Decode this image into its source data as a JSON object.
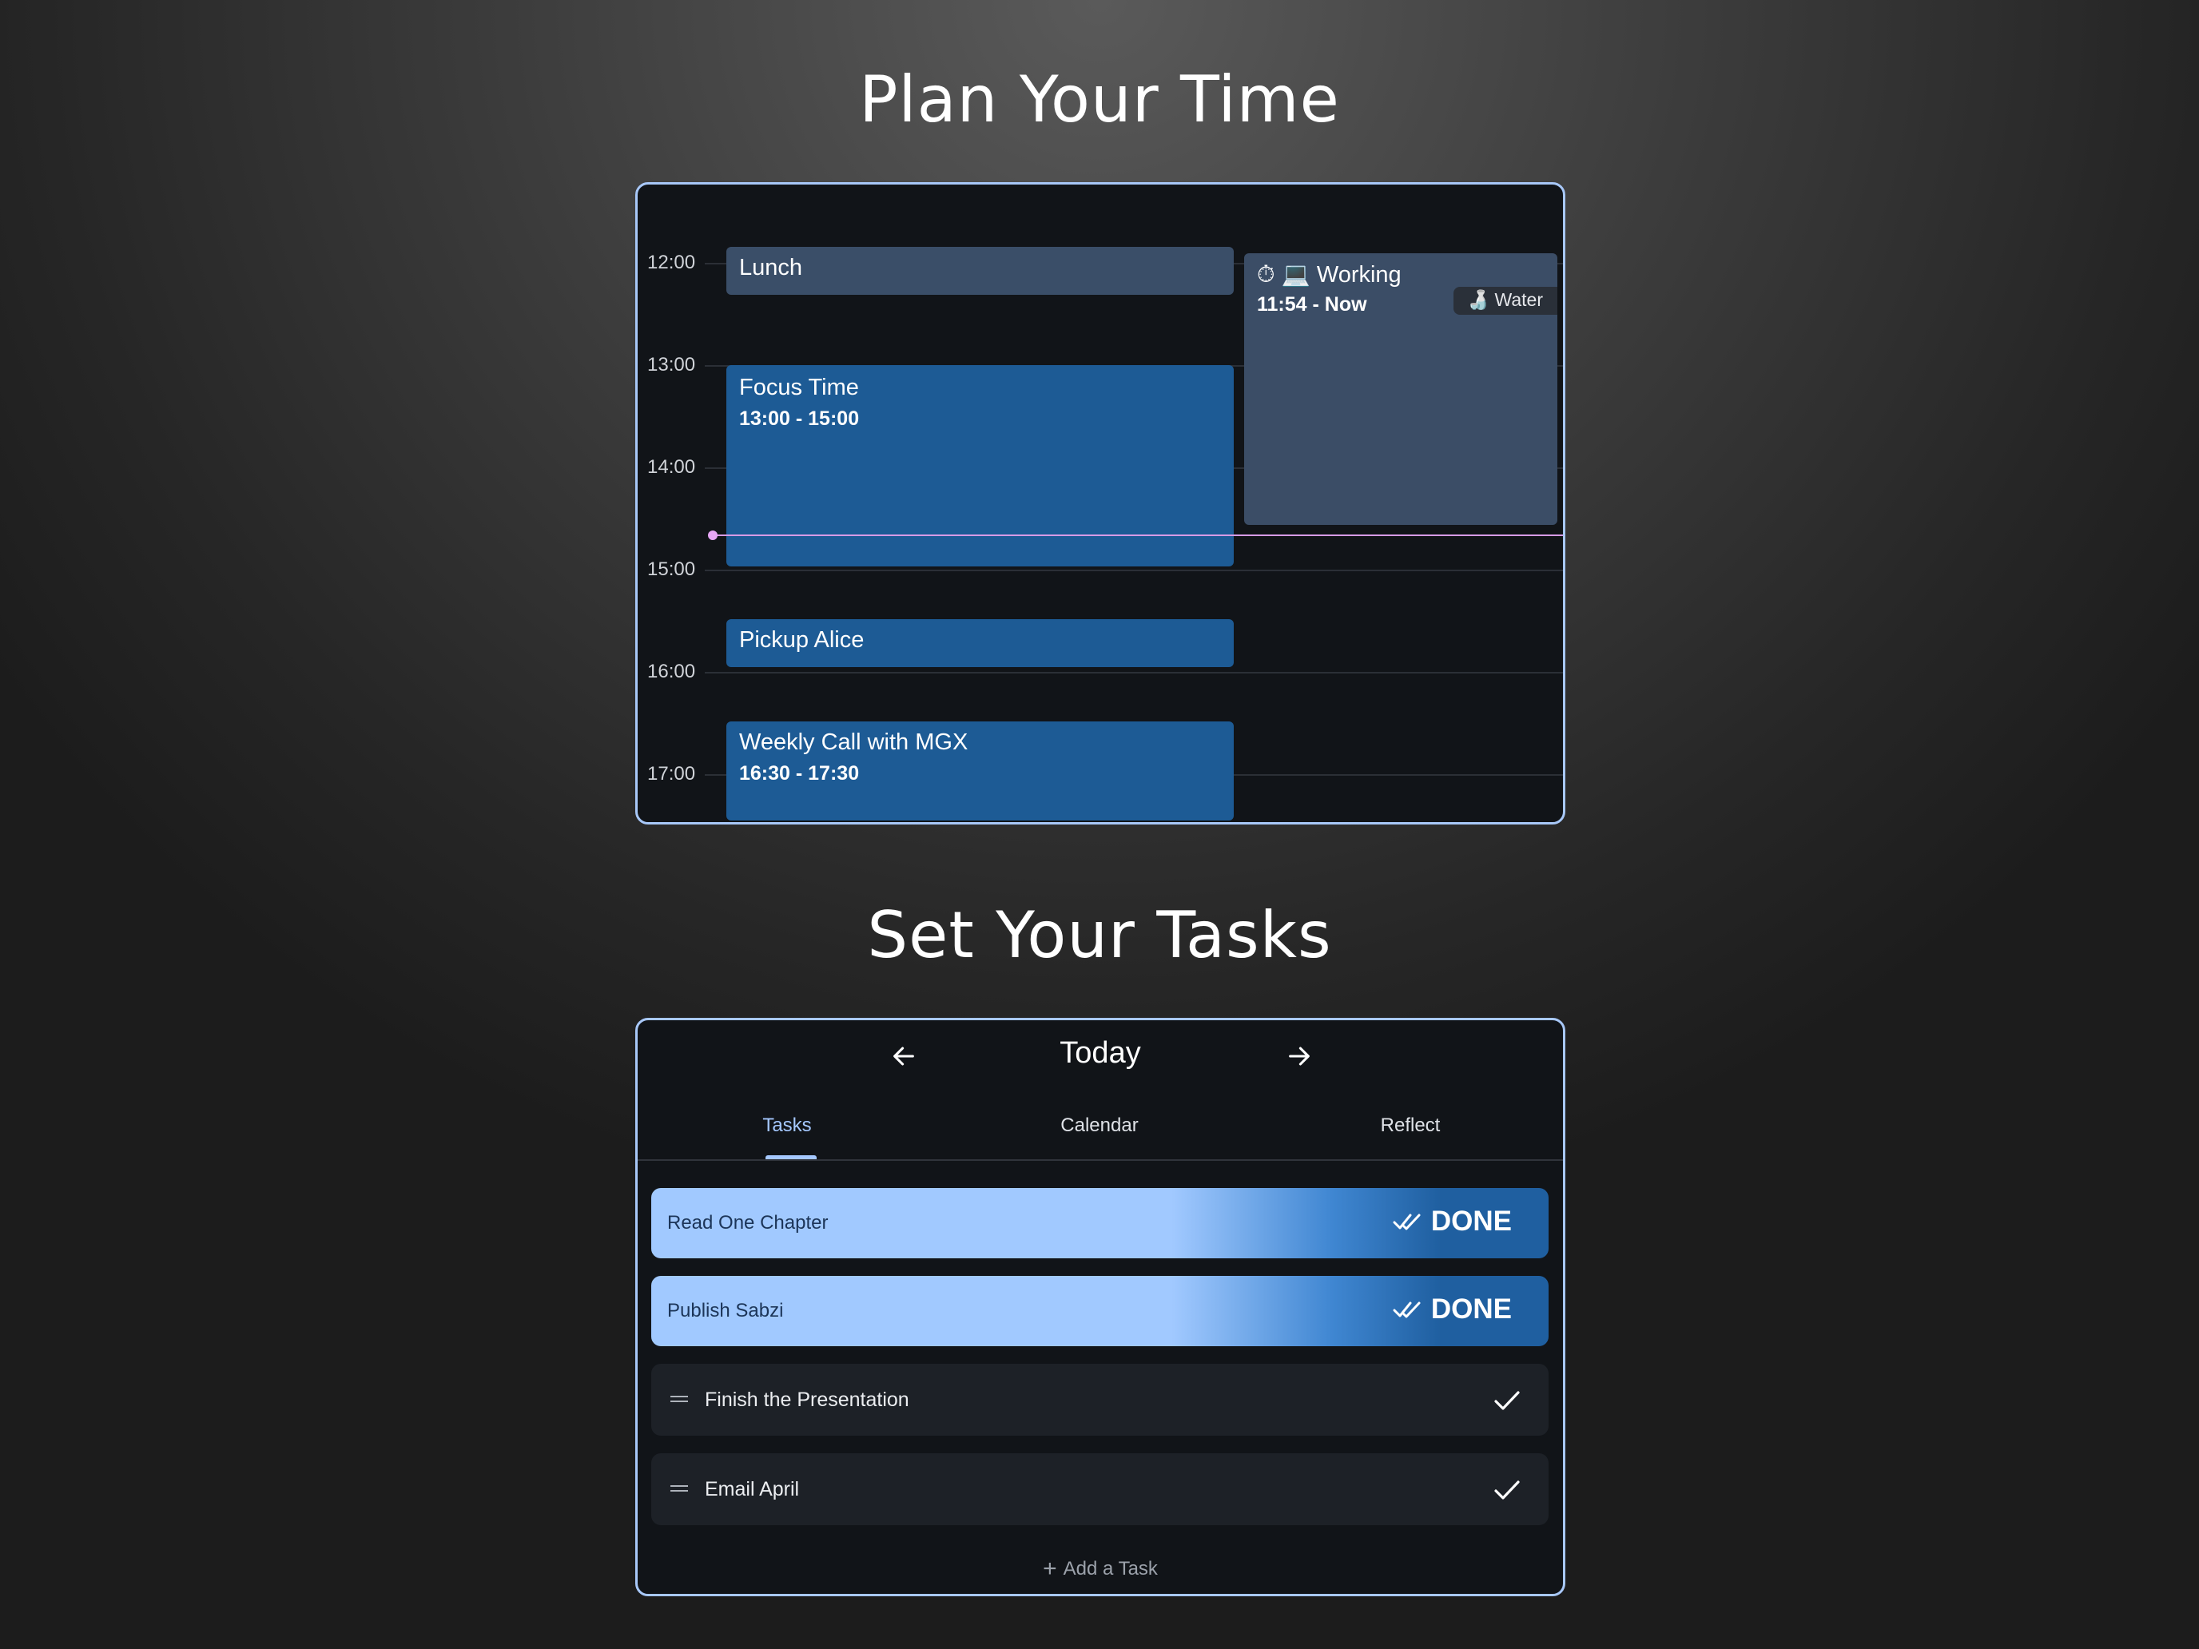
{
  "headings": {
    "plan": "Plan Your Time",
    "tasks": "Set Your Tasks"
  },
  "calendar": {
    "time_labels": [
      "12:00",
      "13:00",
      "14:00",
      "15:00",
      "16:00",
      "17:00"
    ],
    "events": {
      "lunch": {
        "title": "Lunch"
      },
      "focus": {
        "title": "Focus Time",
        "time": "13:00 - 15:00"
      },
      "pickup": {
        "title": "Pickup Alice"
      },
      "weekly": {
        "title": "Weekly Call with MGX",
        "time": "16:30 - 17:30"
      },
      "working": {
        "title": "⏱ 💻 Working",
        "time": "11:54 - Now",
        "chip": "🍶 Water"
      }
    },
    "now_line_color": "#d79be6"
  },
  "tasks_panel": {
    "day_title": "Today",
    "prev_icon": "arrow-left-icon",
    "next_icon": "arrow-right-icon",
    "tabs": {
      "tasks": "Tasks",
      "calendar": "Calendar",
      "reflect": "Reflect"
    },
    "active_tab": "Tasks",
    "done_tasks": [
      {
        "label": "Read One Chapter",
        "status": "DONE"
      },
      {
        "label": "Publish Sabzi",
        "status": "DONE"
      }
    ],
    "open_tasks": [
      {
        "label": "Finish the Presentation"
      },
      {
        "label": "Email April"
      }
    ],
    "add_task": "Add a Task"
  },
  "colors": {
    "accent": "#a5c8ff",
    "panel_border": "#a8c8f8",
    "event_blue": "#1d5b95",
    "event_slate": "#3a4e68"
  }
}
